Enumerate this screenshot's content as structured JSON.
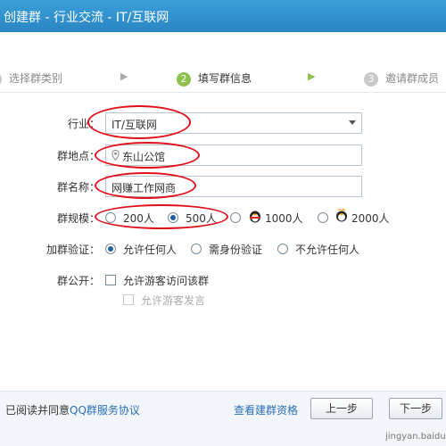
{
  "window": {
    "title": "创建群 - 行业交流 - IT/互联网"
  },
  "steps": [
    {
      "num": "1",
      "label": "选择群类别"
    },
    {
      "num": "2",
      "label": "填写群信息"
    },
    {
      "num": "3",
      "label": "邀请群成员"
    }
  ],
  "form": {
    "industry": {
      "label": "行业：",
      "value": "IT/互联网"
    },
    "location": {
      "label": "群地点：",
      "value": "东山公馆"
    },
    "name": {
      "label": "群名称：",
      "value": "网赚工作网商"
    },
    "size": {
      "label": "群规模：",
      "options": [
        "200人",
        "500人",
        "1000人",
        "2000人"
      ],
      "selected": "500人"
    },
    "verify": {
      "label": "加群验证：",
      "options": [
        "允许任何人",
        "需身份验证",
        "不允许任何人"
      ],
      "selected": "允许任何人"
    },
    "public": {
      "label": "群公开：",
      "option1": "允许游客访问该群",
      "option2": "允许游客发言"
    }
  },
  "footer": {
    "agree_prefix": "已阅读并同意",
    "agree_link": "QQ群服务协议",
    "view_link": "查看建群资格",
    "prev_label": "上一步",
    "next_label": "下一步"
  },
  "watermark": "jingyan.baidu.com",
  "colors": {
    "titlebar": "#2a86c4",
    "annotation": "#e0101a",
    "link": "#2a6fb6",
    "step_active": "#8fc14d"
  }
}
